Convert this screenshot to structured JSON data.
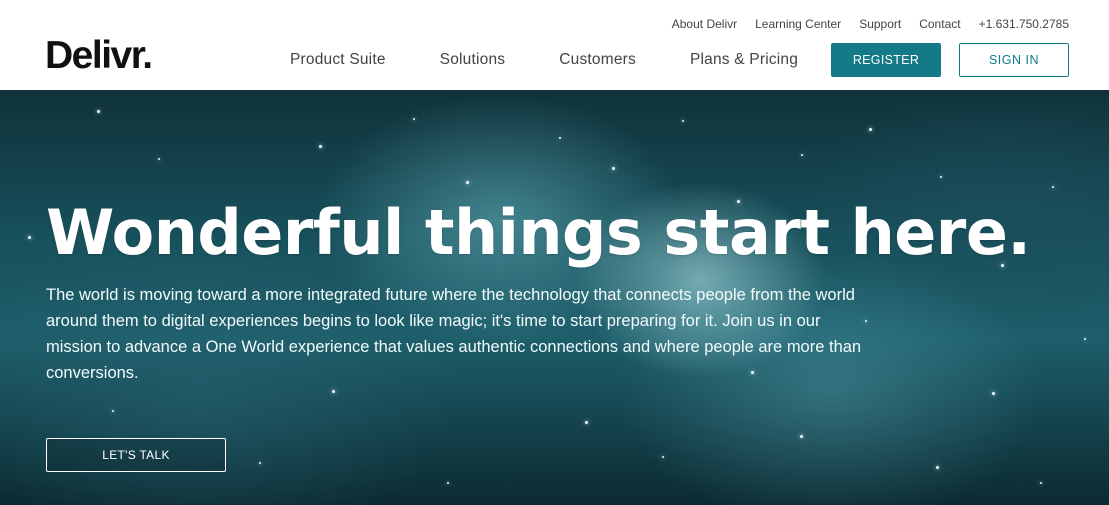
{
  "header": {
    "logo": "Delivr.",
    "utility_nav": [
      "About Delivr",
      "Learning Center",
      "Support",
      "Contact",
      "+1.631.750.2785"
    ],
    "main_nav": [
      "Product Suite",
      "Solutions",
      "Customers",
      "Plans & Pricing"
    ],
    "register_label": "REGISTER",
    "signin_label": "SIGN IN"
  },
  "hero": {
    "title": "Wonderful things start here.",
    "body": "The world is moving toward a more integrated future where the technology that connects people from the world around them to digital experiences begins to look like magic; it's time to start preparing for it. Join us in our mission to advance a One World experience that values authentic connections and where people are more than conversions.",
    "cta_label": "LET'S TALK"
  },
  "colors": {
    "accent": "#147a87",
    "header_bg": "#ffffff",
    "hero_bg": "#17505b"
  }
}
